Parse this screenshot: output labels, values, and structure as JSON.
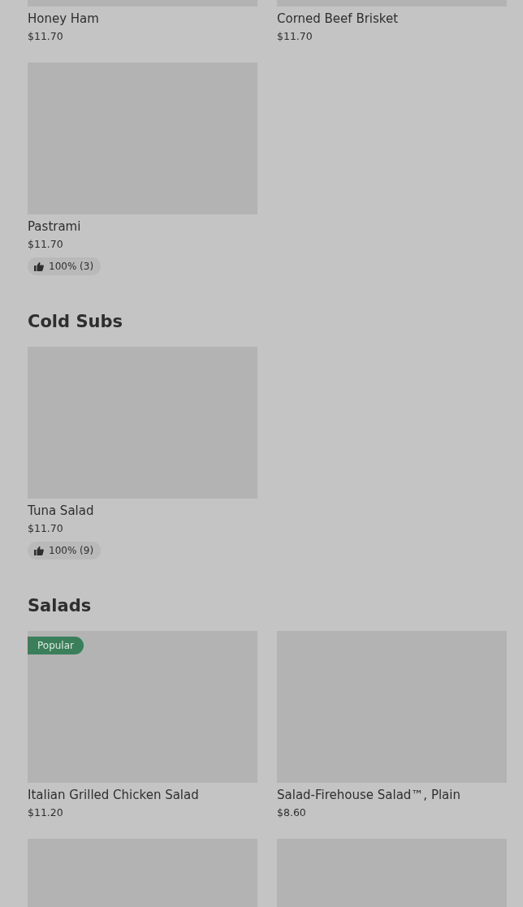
{
  "sections": [
    {
      "items": [
        {
          "kind": "card",
          "name": "Honey Ham",
          "price": "$11.70"
        },
        {
          "kind": "card",
          "name": "Corned Beef Brisket",
          "price": "$11.70"
        },
        {
          "kind": "card",
          "name": "Pastrami",
          "price": "$11.70",
          "rating": "100% (3)"
        }
      ]
    },
    {
      "title": "Cold Subs",
      "items": [
        {
          "kind": "card",
          "name": "Tuna Salad",
          "price": "$11.70",
          "rating": "100% (9)"
        }
      ]
    },
    {
      "title": "Salads",
      "items": [
        {
          "kind": "card",
          "name": "Italian Grilled Chicken Salad",
          "price": "$11.20",
          "badge": "Popular"
        },
        {
          "kind": "card",
          "name": "Salad-Firehouse Salad™, Plain",
          "price": "$8.60"
        },
        {
          "kind": "image-only"
        },
        {
          "kind": "image-only"
        }
      ]
    }
  ]
}
